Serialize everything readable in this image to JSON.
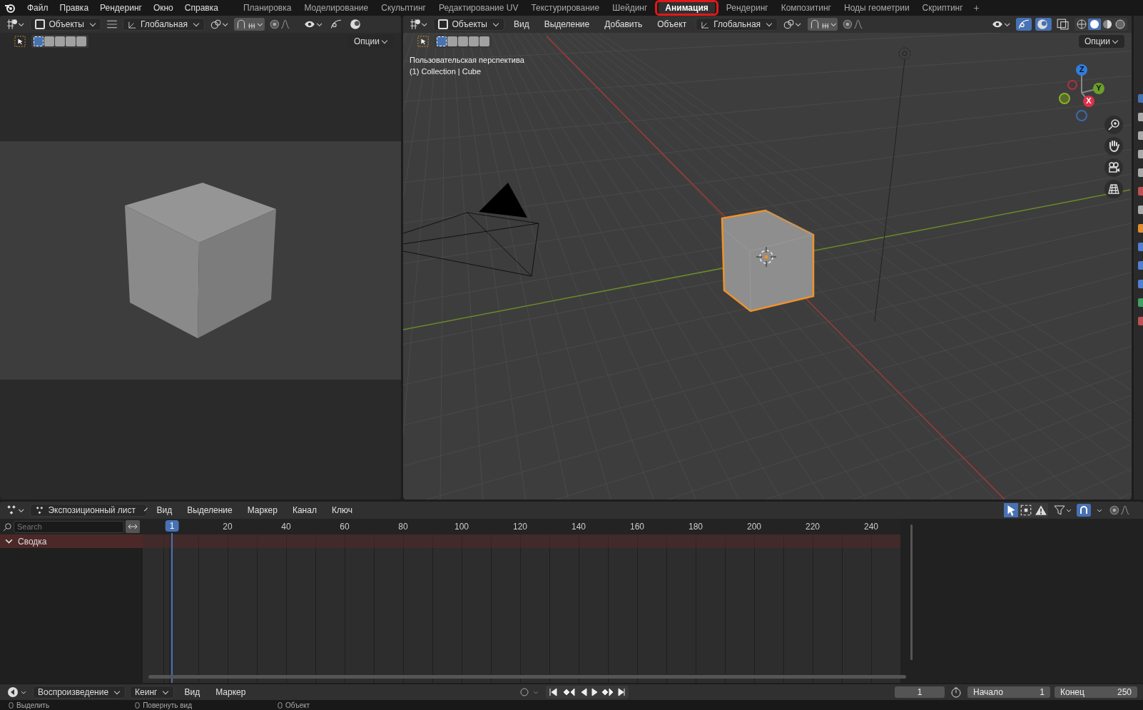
{
  "top_bar": {
    "menu": [
      "Файл",
      "Правка",
      "Рендеринг",
      "Окно",
      "Справка"
    ],
    "workspaces": [
      {
        "label": "Планировка",
        "selected": false
      },
      {
        "label": "Моделирование",
        "selected": false
      },
      {
        "label": "Скульптинг",
        "selected": false
      },
      {
        "label": "Редактирование UV",
        "selected": false
      },
      {
        "label": "Текстурирование",
        "selected": false
      },
      {
        "label": "Шейдинг",
        "selected": false
      },
      {
        "label": "Анимация",
        "selected": true
      },
      {
        "label": "Рендеринг",
        "selected": false
      },
      {
        "label": "Композитинг",
        "selected": false
      },
      {
        "label": "Ноды геометрии",
        "selected": false
      },
      {
        "label": "Скриптинг",
        "selected": false
      }
    ],
    "add_tab": "+"
  },
  "camera_viewport": {
    "mode": "Объекты",
    "orientation": "Глобальная",
    "options": "Опции"
  },
  "main_viewport": {
    "mode": "Объекты",
    "menu": [
      "Вид",
      "Выделение",
      "Добавить",
      "Объект"
    ],
    "orientation": "Глобальная",
    "options": "Опции",
    "view_name": "Пользовательская перспектива",
    "collection_info": "(1) Collection | Cube",
    "gizmo_axes": [
      "Z",
      "Y",
      "X"
    ]
  },
  "dope_sheet": {
    "editor": "Экспозиционный лист",
    "menu": [
      "Вид",
      "Выделение",
      "Маркер",
      "Канал",
      "Ключ"
    ],
    "search": {
      "placeholder": "Search"
    },
    "current_frame": "1",
    "ruler": [
      "20",
      "40",
      "60",
      "80",
      "100",
      "120",
      "140",
      "160",
      "180",
      "200",
      "220",
      "240"
    ],
    "channels": [
      {
        "label": "Сводка",
        "expanded": true
      }
    ]
  },
  "timeline": {
    "playback": "Воспроизведение",
    "keying": "Кеинг",
    "menu": [
      "Вид",
      "Маркер"
    ],
    "frame": "1",
    "start_label": "Начало",
    "start": "1",
    "end_label": "Конец",
    "end": "250"
  },
  "status_bar": [
    "Выделить",
    "Повернуть вид",
    "Объект"
  ]
}
